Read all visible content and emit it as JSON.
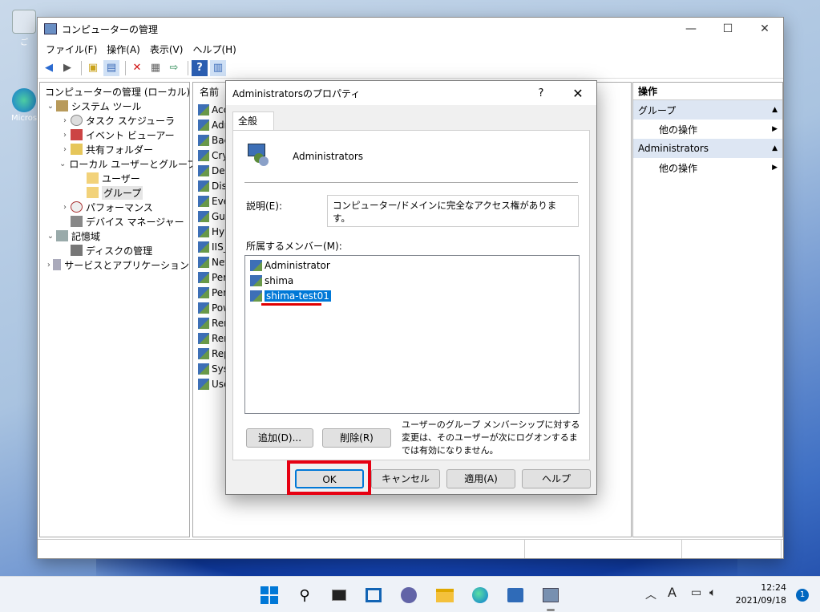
{
  "desktop": {
    "icon1_label": "ご",
    "icon2_label": "Micros"
  },
  "window": {
    "title": "コンピューターの管理",
    "controls": {
      "min": "—",
      "max": "☐",
      "close": "✕"
    },
    "menu": [
      "ファイル(F)",
      "操作(A)",
      "表示(V)",
      "ヘルプ(H)"
    ],
    "tree": [
      {
        "label": "コンピューターの管理 (ローカル)",
        "level": 0,
        "chev": ""
      },
      {
        "label": "システム ツール",
        "level": 1,
        "chev": "⌄"
      },
      {
        "label": "タスク スケジューラ",
        "level": 2,
        "chev": "›"
      },
      {
        "label": "イベント ビューアー",
        "level": 2,
        "chev": "›"
      },
      {
        "label": "共有フォルダー",
        "level": 2,
        "chev": "›"
      },
      {
        "label": "ローカル ユーザーとグループ",
        "level": 2,
        "chev": "⌄"
      },
      {
        "label": "ユーザー",
        "level": 3,
        "chev": ""
      },
      {
        "label": "グループ",
        "level": 3,
        "chev": "",
        "selected": true
      },
      {
        "label": "パフォーマンス",
        "level": 2,
        "chev": "›"
      },
      {
        "label": "デバイス マネージャー",
        "level": 2,
        "chev": ""
      },
      {
        "label": "記憶域",
        "level": 1,
        "chev": "⌄"
      },
      {
        "label": "ディスクの管理",
        "level": 2,
        "chev": ""
      },
      {
        "label": "サービスとアプリケーション",
        "level": 1,
        "chev": "›"
      }
    ],
    "list_header": "名前",
    "list_items": [
      "Acc",
      "Adr",
      "Bac",
      "Cry",
      "Dev",
      "Dist",
      "Eve",
      "Gue",
      "Hyp",
      "IIS_",
      "Net",
      "Per",
      "Per",
      "Pow",
      "Ren",
      "Ren",
      "Rep",
      "Sys",
      "Use"
    ],
    "actions": {
      "header": "操作",
      "groups": [
        {
          "label": "グループ",
          "op": "他の操作"
        },
        {
          "label": "Administrators",
          "op": "他の操作"
        }
      ]
    }
  },
  "dialog": {
    "title": "Administratorsのプロパティ",
    "help": "?",
    "close": "✕",
    "tab": "全般",
    "group_name": "Administrators",
    "desc_label": "説明(E):",
    "desc_value": "コンピューター/ドメインに完全なアクセス権があります。",
    "members_label": "所属するメンバー(M):",
    "members": [
      {
        "name": "Administrator",
        "selected": false
      },
      {
        "name": "shima",
        "selected": false
      },
      {
        "name": "shima-test01",
        "selected": true
      }
    ],
    "add_btn": "追加(D)...",
    "remove_btn": "削除(R)",
    "note": "ユーザーのグループ メンバーシップに対する変更は、そのユーザーが次にログオンするまでは有効になりません。",
    "ok": "OK",
    "cancel": "キャンセル",
    "apply": "適用(A)",
    "help_btn": "ヘルプ"
  },
  "taskbar": {
    "time": "12:24",
    "date": "2021/09/18",
    "notif_count": "1",
    "ime": "A",
    "colors": {
      "accent": "#0078d7",
      "highlight": "#e60012"
    }
  }
}
